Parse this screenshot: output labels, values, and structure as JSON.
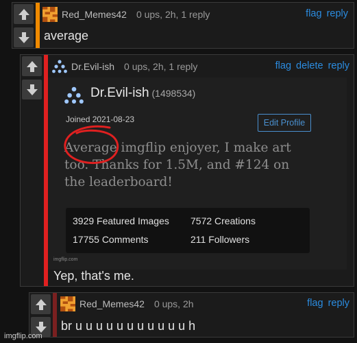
{
  "comments": [
    {
      "username": "Red_Memes42",
      "meta": "0 ups, 2h, 1 reply",
      "body": "average",
      "actions": [
        "flag",
        "reply"
      ],
      "accent_color": "#f08a00"
    },
    {
      "username": "Dr.Evil-ish",
      "meta": "0 ups, 2h, 1 reply",
      "body": "Yep, that's me.",
      "actions": [
        "flag",
        "delete",
        "reply"
      ],
      "accent_color": "#e02020",
      "embedded_profile": {
        "name": "Dr.Evil-ish",
        "id": "(1498534)",
        "joined": "Joined 2021-08-23",
        "edit_button": "Edit Profile",
        "bio": "Average imgflip enjoyer, I make art too. Thanks for 1.5M, and #124 on the leaderboard!",
        "stats": [
          "3929 Featured Images",
          "7572 Creations",
          "17755 Comments",
          "211 Followers"
        ],
        "watermark": "imgflip.com"
      }
    },
    {
      "username": "Red_Memes42",
      "meta": "0 ups, 2h",
      "body": "br u u u u u u u u u u u h",
      "actions": [
        "flag",
        "reply"
      ],
      "accent_color": "#7a2020"
    }
  ],
  "site_watermark": "imgflip.com",
  "link_color": "#2b8ce0",
  "icons": {
    "upvote": "arrow-up-icon",
    "downvote": "arrow-down-icon"
  }
}
